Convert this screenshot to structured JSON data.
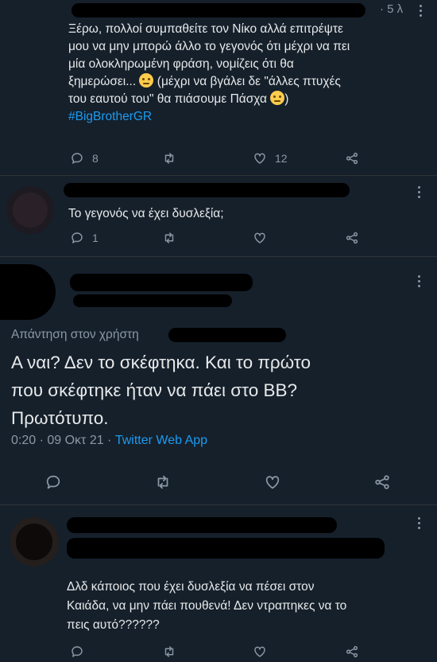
{
  "tweet1": {
    "time": "· 5 λ",
    "text_line1": "Ξέρω, πολλοί συμπαθείτε τον Νίκο αλλά επιτρέψτε",
    "text_line2": "μου να μην μπορώ άλλο το γεγονός ότι μέχρι να πει",
    "text_line3": "μία ολοκληρωμένη φράση, νομίζεις ότι θα",
    "text_line4": "ξημερώσει...",
    "text_line4b": "(μέχρι να βγάλει δε \"άλλες πτυχές",
    "text_line5": "του εαυτού του\" θα πιάσουμε Πάσχα",
    "text_line5b": ")",
    "hashtag": "#BigBrotherGR",
    "reply_count": "8",
    "like_count": "12"
  },
  "tweet2": {
    "text": "Το γεγονός να έχει δυσλεξία;",
    "reply_count": "1"
  },
  "main": {
    "replying_to": "Απάντηση στον χρήστη",
    "line1": "Α ναι? Δεν το σκέφτηκα. Και το πρώτο",
    "line2": "που σκέφτηκε ήταν να πάει στο ΒΒ?",
    "line3": "Πρωτότυπο.",
    "time": "0:20 · 09 Οκτ 21 ·",
    "app": "Twitter Web App"
  },
  "tweet3": {
    "line1": "Δλδ κάποιος που έχει δυσλεξία να πέσει στον",
    "line2": "Καιάδα, να μην πάει πουθενά! Δεν ντραπηκες να το",
    "line3": "πεις αυτό??????"
  },
  "colors": {
    "background": "#15202b",
    "text": "#e7e9ea",
    "muted": "#8b98a5",
    "link": "#1d9bf0"
  }
}
